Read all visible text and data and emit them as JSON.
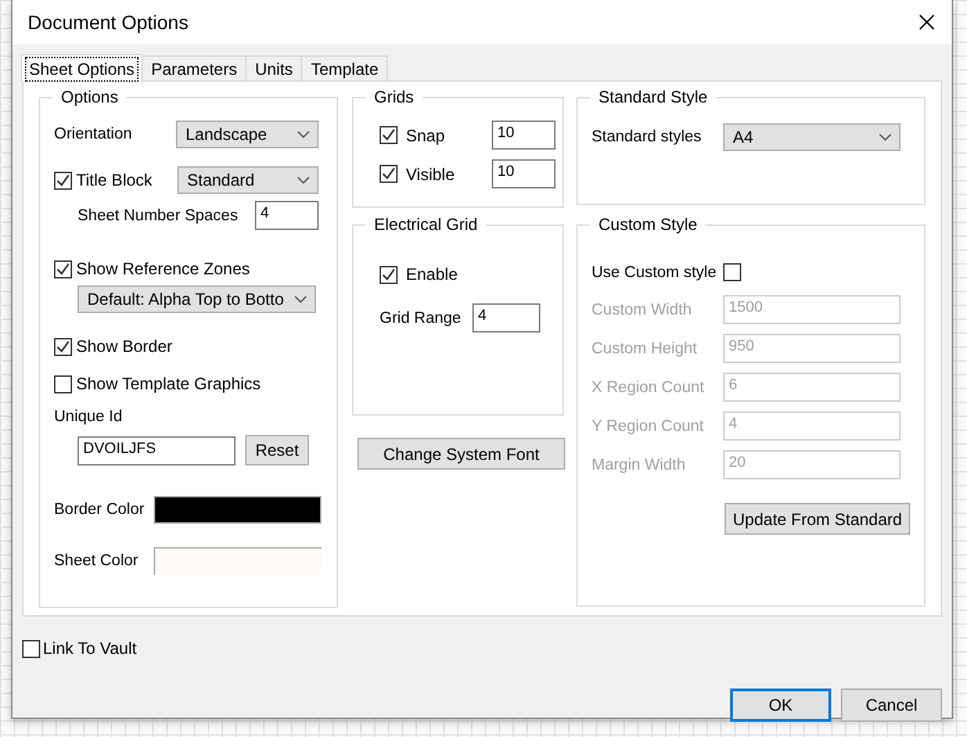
{
  "window": {
    "title": "Document Options"
  },
  "tabs": [
    {
      "label": "Sheet Options",
      "selected": true
    },
    {
      "label": "Parameters",
      "selected": false
    },
    {
      "label": "Units",
      "selected": false
    },
    {
      "label": "Template",
      "selected": false
    }
  ],
  "options": {
    "title": "Options",
    "orientation": {
      "label": "Orientation",
      "value": "Landscape"
    },
    "title_block": {
      "label": "Title Block",
      "checked": true,
      "value": "Standard"
    },
    "sheet_number_spaces": {
      "label": "Sheet Number Spaces",
      "value": "4"
    },
    "reference_zones": {
      "label": "Show Reference Zones",
      "checked": true,
      "value": "Default: Alpha Top to Botto"
    },
    "show_border": {
      "label": "Show Border",
      "checked": true
    },
    "show_template_graphics": {
      "label": "Show Template Graphics",
      "checked": false
    },
    "unique_id": {
      "label": "Unique Id",
      "value": "DVOILJFS",
      "button": "Reset"
    },
    "border_color": {
      "label": "Border Color",
      "color": "#000000"
    },
    "sheet_color": {
      "label": "Sheet Color",
      "color": "#fffaf6"
    }
  },
  "grids": {
    "title": "Grids",
    "items": [
      {
        "label": "Snap",
        "checked": true,
        "value": "10"
      },
      {
        "label": "Visible",
        "checked": true,
        "value": "10"
      }
    ]
  },
  "electrical_grid": {
    "title": "Electrical Grid",
    "enable": {
      "label": "Enable",
      "checked": true
    },
    "grid_range": {
      "label": "Grid Range",
      "value": "4"
    }
  },
  "change_font_button": "Change System Font",
  "standard_style": {
    "title": "Standard Style",
    "label": "Standard styles",
    "value": "A4"
  },
  "custom_style": {
    "title": "Custom Style",
    "use": {
      "label": "Use Custom style",
      "checked": false
    },
    "fields": [
      {
        "label": "Custom Width",
        "value": "1500",
        "disabled": true
      },
      {
        "label": "Custom Height",
        "value": "950",
        "disabled": true
      },
      {
        "label": "X Region Count",
        "value": "6",
        "disabled": true
      },
      {
        "label": "Y Region Count",
        "value": "4",
        "disabled": true
      },
      {
        "label": "Margin Width",
        "value": "20",
        "disabled": true
      }
    ],
    "button": "Update From Standard"
  },
  "link_to_vault": {
    "label": "Link To Vault",
    "checked": false
  },
  "buttons": [
    {
      "label": "OK",
      "default": true
    },
    {
      "label": "Cancel",
      "default": false
    }
  ]
}
